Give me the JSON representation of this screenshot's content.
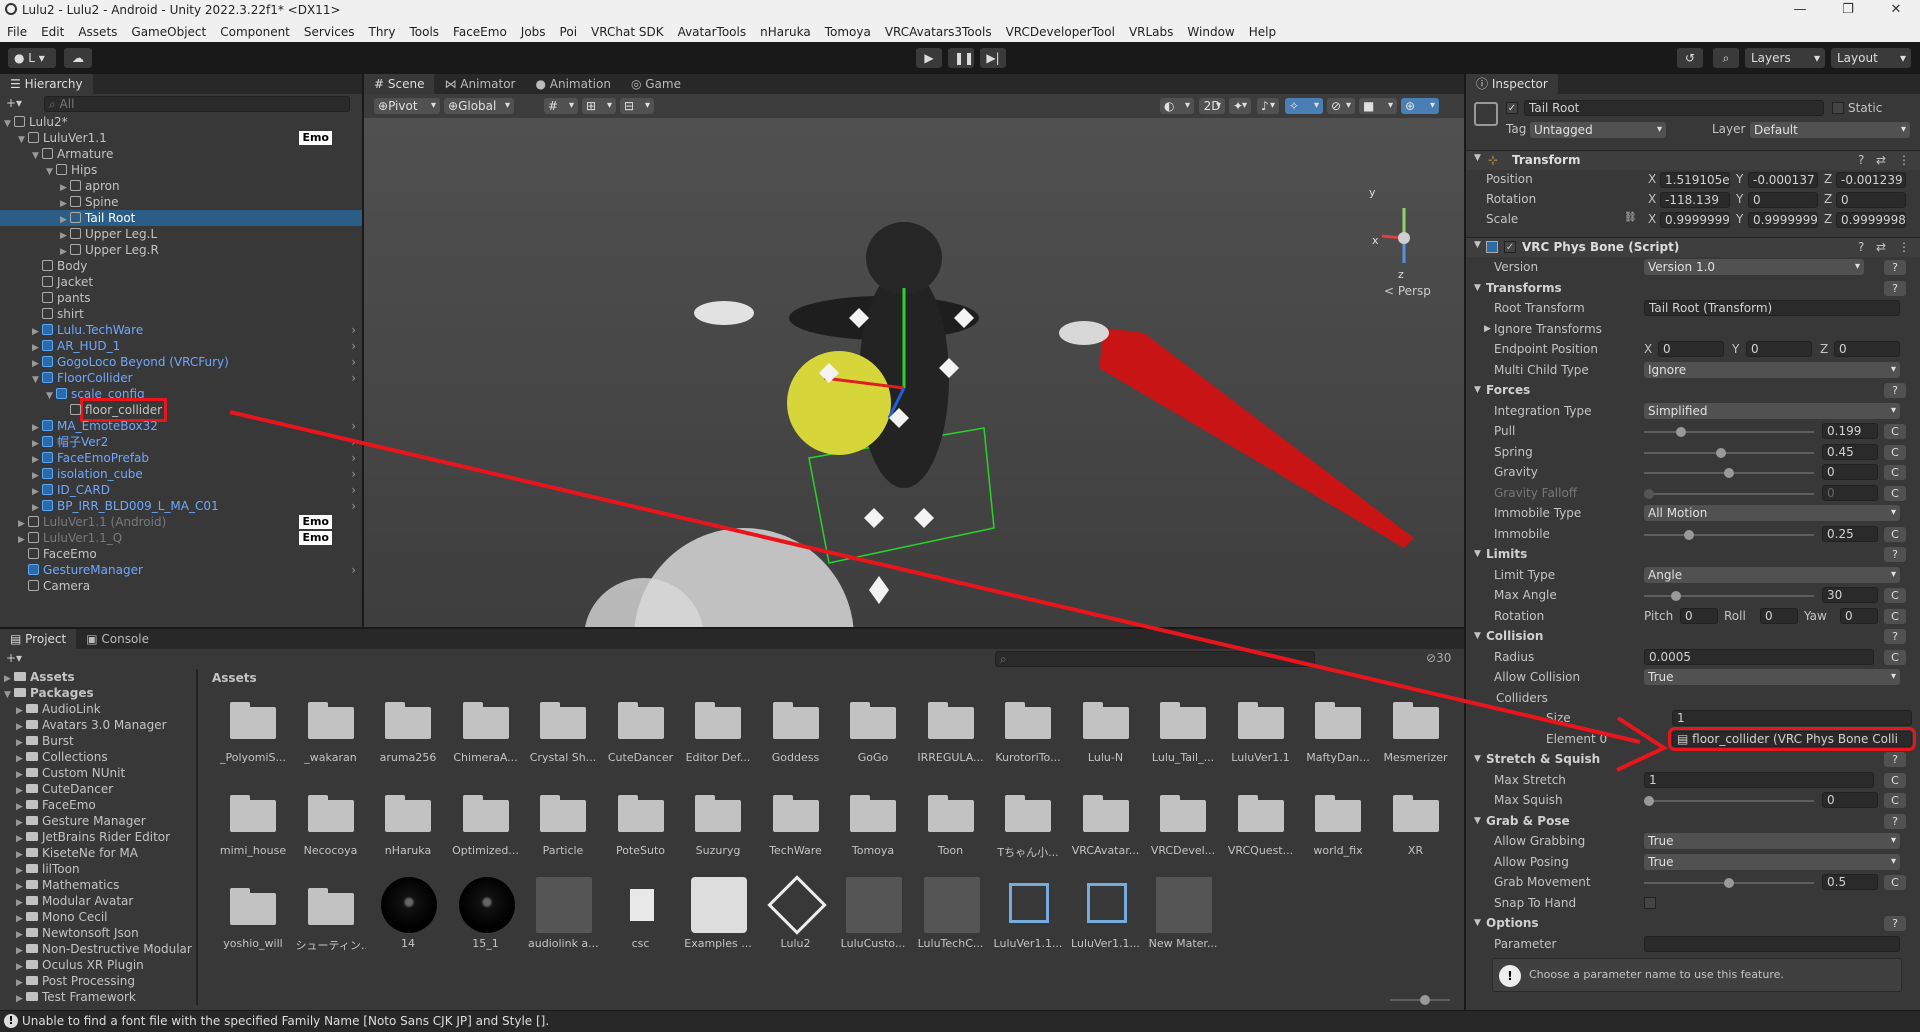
{
  "window": {
    "title": "Lulu2 - Lulu2 - Android - Unity 2022.3.22f1* <DX11>",
    "minimize": "—",
    "maximize": "❐",
    "close": "✕"
  },
  "menu": [
    "File",
    "Edit",
    "Assets",
    "GameObject",
    "Component",
    "Services",
    "Thry",
    "Tools",
    "FaceEmo",
    "Jobs",
    "Poi",
    "VRChat SDK",
    "AvatarTools",
    "nHaruka",
    "Tomoya",
    "VRCAvatars3Tools",
    "VRCDeveloperTool",
    "VRLabs",
    "Window",
    "Help"
  ],
  "toolbar": {
    "account": "L",
    "layers": "Layers",
    "layout": "Layout"
  },
  "hierarchy": {
    "tab": "Hierarchy",
    "search_placeholder": "All",
    "items": [
      {
        "label": "Lulu2*",
        "indent": 0,
        "arrow": "▼",
        "kind": "scene"
      },
      {
        "label": "LuluVer1.1",
        "indent": 1,
        "arrow": "▼",
        "emo": "Emo"
      },
      {
        "label": "Armature",
        "indent": 2,
        "arrow": "▼"
      },
      {
        "label": "Hips",
        "indent": 3,
        "arrow": "▼"
      },
      {
        "label": "apron",
        "indent": 4,
        "arrow": "▶"
      },
      {
        "label": "Spine",
        "indent": 4,
        "arrow": "▶"
      },
      {
        "label": "Tail Root",
        "indent": 4,
        "arrow": "▶",
        "selected": true
      },
      {
        "label": "Upper Leg.L",
        "indent": 4,
        "arrow": "▶"
      },
      {
        "label": "Upper Leg.R",
        "indent": 4,
        "arrow": "▶"
      },
      {
        "label": "Body",
        "indent": 2,
        "arrow": ""
      },
      {
        "label": "Jacket",
        "indent": 2,
        "arrow": ""
      },
      {
        "label": "pants",
        "indent": 2,
        "arrow": ""
      },
      {
        "label": "shirt",
        "indent": 2,
        "arrow": ""
      },
      {
        "label": "Lulu.TechWare",
        "indent": 2,
        "arrow": "▶",
        "blue": true,
        "chev": true
      },
      {
        "label": "AR_HUD_1",
        "indent": 2,
        "arrow": "▶",
        "blue": true,
        "chev": true
      },
      {
        "label": "GogoLoco Beyond (VRCFury)",
        "indent": 2,
        "arrow": "▶",
        "blue": true,
        "chev": true
      },
      {
        "label": "FloorCollider",
        "indent": 2,
        "arrow": "▼",
        "blue": true,
        "chev": true
      },
      {
        "label": "scale_config",
        "indent": 3,
        "arrow": "▼",
        "blue": true
      },
      {
        "label": "floor_collider",
        "indent": 4,
        "arrow": "",
        "boxed": true
      },
      {
        "label": "MA_EmoteBox32",
        "indent": 2,
        "arrow": "▶",
        "blue": true,
        "chev": true
      },
      {
        "label": "帽子Ver2",
        "indent": 2,
        "arrow": "▶",
        "blue": true,
        "chev": true
      },
      {
        "label": "FaceEmoPrefab",
        "indent": 2,
        "arrow": "▶",
        "blue": true,
        "chev": true
      },
      {
        "label": "isolation_cube",
        "indent": 2,
        "arrow": "▶",
        "blue": true,
        "chev": true
      },
      {
        "label": "ID_CARD",
        "indent": 2,
        "arrow": "▶",
        "blue": true,
        "chev": true
      },
      {
        "label": "BP_IRR_BLD009_L_MA_C01",
        "indent": 2,
        "arrow": "▶",
        "blue": true,
        "chev": true
      },
      {
        "label": "LuluVer1.1 (Android)",
        "indent": 1,
        "arrow": "▶",
        "grey": true,
        "emo": "Emo"
      },
      {
        "label": "LuluVer1.1_Q",
        "indent": 1,
        "arrow": "▶",
        "grey": true,
        "emo": "Emo"
      },
      {
        "label": "FaceEmo",
        "indent": 1,
        "arrow": ""
      },
      {
        "label": "GestureManager",
        "indent": 1,
        "arrow": "",
        "blue": true,
        "chev": true
      },
      {
        "label": "Camera",
        "indent": 1,
        "arrow": ""
      }
    ]
  },
  "scene": {
    "tabs": [
      "Scene",
      "Animator",
      "Animation",
      "Game"
    ],
    "pivot": "Pivot",
    "global": "Global",
    "mode2d": "2D",
    "persp": "< Persp",
    "gizmo_x": "x",
    "gizmo_y": "y",
    "gizmo_z": "z"
  },
  "inspector": {
    "tab": "Inspector",
    "object_name": "Tail Root",
    "static_label": "Static",
    "tag_label": "Tag",
    "tag_value": "Untagged",
    "layer_label": "Layer",
    "layer_value": "Default",
    "transform": {
      "title": "Transform",
      "position_label": "Position",
      "rotation_label": "Rotation",
      "scale_label": "Scale",
      "position": [
        "1.519105e-",
        "-0.000137",
        "-0.001239"
      ],
      "rotation": [
        "-118.139",
        "0",
        "0"
      ],
      "scale": [
        "0.9999999",
        "0.9999999",
        "0.9999998"
      ]
    },
    "physbone": {
      "title": "VRC Phys Bone (Script)",
      "version_label": "Version",
      "version": "Version 1.0",
      "transforms_label": "Transforms",
      "root_transform_label": "Root Transform",
      "root_transform": "Tail Root (Transform)",
      "ignore_transforms_label": "Ignore Transforms",
      "endpoint_label": "Endpoint Position",
      "endpoint": [
        "0",
        "0",
        "0"
      ],
      "multi_child_label": "Multi Child Type",
      "multi_child": "Ignore",
      "forces_label": "Forces",
      "integration_label": "Integration Type",
      "integration": "Simplified",
      "pull_label": "Pull",
      "pull": "0.199",
      "spring_label": "Spring",
      "spring": "0.45",
      "gravity_label": "Gravity",
      "gravity": "0",
      "gravity_falloff_label": "Gravity Falloff",
      "gravity_falloff": "0",
      "immobile_type_label": "Immobile Type",
      "immobile_type": "All Motion",
      "immobile_label": "Immobile",
      "immobile": "0.25",
      "limits_label": "Limits",
      "limit_type_label": "Limit Type",
      "limit_type": "Angle",
      "max_angle_label": "Max Angle",
      "max_angle": "30",
      "rotation_label": "Rotation",
      "pitch_label": "Pitch",
      "pitch": "0",
      "roll_label": "Roll",
      "roll": "0",
      "yaw_label": "Yaw",
      "yaw": "0",
      "collision_label": "Collision",
      "radius_label": "Radius",
      "radius": "0.0005",
      "allow_collision_label": "Allow Collision",
      "allow_collision": "True",
      "colliders_label": "Colliders",
      "size_label": "Size",
      "size": "1",
      "element0_label": "Element 0",
      "element0": "floor_collider (VRC Phys Bone Colli",
      "stretch_label": "Stretch & Squish",
      "max_stretch_label": "Max Stretch",
      "max_stretch": "1",
      "max_squish_label": "Max Squish",
      "max_squish": "0",
      "grab_label": "Grab & Pose",
      "allow_grabbing_label": "Allow Grabbing",
      "allow_grabbing": "True",
      "allow_posing_label": "Allow Posing",
      "allow_posing": "True",
      "grab_movement_label": "Grab Movement",
      "grab_movement": "0.5",
      "snap_label": "Snap To Hand",
      "options_label": "Options",
      "parameter_label": "Parameter",
      "parameter_hint": "Choose a parameter name to use this feature.",
      "c_btn": "C",
      "help_btn": "?"
    }
  },
  "project": {
    "tabs": [
      "Project",
      "Console"
    ],
    "breadcrumb": "Assets",
    "hidden_count": "30",
    "tree": [
      {
        "label": "Assets",
        "indent": 0,
        "arrow": "▶",
        "bold": true
      },
      {
        "label": "Packages",
        "indent": 0,
        "arrow": "▼",
        "bold": true
      },
      {
        "label": "AudioLink",
        "indent": 1
      },
      {
        "label": "Avatars 3.0 Manager",
        "indent": 1
      },
      {
        "label": "Burst",
        "indent": 1
      },
      {
        "label": "Collections",
        "indent": 1
      },
      {
        "label": "Custom NUnit",
        "indent": 1
      },
      {
        "label": "CuteDancer",
        "indent": 1
      },
      {
        "label": "FaceEmo",
        "indent": 1
      },
      {
        "label": "Gesture Manager",
        "indent": 1
      },
      {
        "label": "JetBrains Rider Editor",
        "indent": 1
      },
      {
        "label": "KiseteNe for MA",
        "indent": 1
      },
      {
        "label": "lilToon",
        "indent": 1
      },
      {
        "label": "Mathematics",
        "indent": 1
      },
      {
        "label": "Modular Avatar",
        "indent": 1
      },
      {
        "label": "Mono Cecil",
        "indent": 1
      },
      {
        "label": "Newtonsoft Json",
        "indent": 1
      },
      {
        "label": "Non-Destructive Modular",
        "indent": 1
      },
      {
        "label": "Oculus XR Plugin",
        "indent": 1
      },
      {
        "label": "Post Processing",
        "indent": 1
      },
      {
        "label": "Test Framework",
        "indent": 1
      }
    ],
    "assets_row1": [
      "_PolyomiS...",
      "_wakaran",
      "aruma256",
      "ChimeraA...",
      "Crystal Sh...",
      "CuteDancer",
      "Editor Def...",
      "Goddess",
      "GoGo",
      "IRREGULA...",
      "KurotoriTo...",
      "Lulu-N",
      "Lulu_Tail_...",
      "LuluVer1.1",
      "MaftyDan...",
      "Mesmerizer"
    ],
    "assets_row2": [
      "mimi_house",
      "Necocoya",
      "nHaruka",
      "Optimized...",
      "Particle",
      "PoteSuto",
      "Suzuryg",
      "TechWare",
      "Tomoya",
      "Toon",
      "Tちゃん小...",
      "VRCAvatar...",
      "VRCDevel...",
      "VRCQuest...",
      "world_fix",
      "XR"
    ],
    "assets_row3": [
      {
        "label": "yoshio_will",
        "kind": "folder"
      },
      {
        "label": "シューティン...",
        "kind": "folder"
      },
      {
        "label": "14",
        "kind": "sphere"
      },
      {
        "label": "15_1",
        "kind": "sphere"
      },
      {
        "label": "audiolink a...",
        "kind": "anim"
      },
      {
        "label": "csc",
        "kind": "file"
      },
      {
        "label": "Examples ...",
        "kind": "doc"
      },
      {
        "label": "Lulu2",
        "kind": "unity"
      },
      {
        "label": "LuluCusto...",
        "kind": "prefabanim"
      },
      {
        "label": "LuluTechC...",
        "kind": "prefabanim"
      },
      {
        "label": "LuluVer1.1...",
        "kind": "ctrl"
      },
      {
        "label": "LuluVer1.1...",
        "kind": "ctrl"
      },
      {
        "label": "New Mater...",
        "kind": "mat"
      }
    ]
  },
  "status": {
    "message": "Unable to find a font file with the specified Family Name [Noto Sans CJK JP] and Style []."
  },
  "colors": {
    "accent_red": "#e8161c",
    "selection": "#2c5d87",
    "prefab_blue": "#6ea8ff"
  }
}
